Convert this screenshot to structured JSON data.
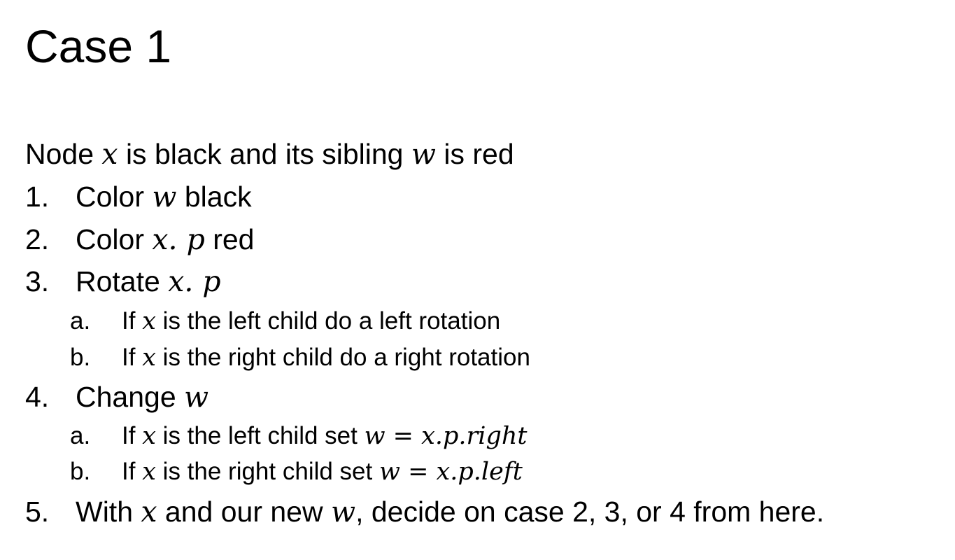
{
  "slide": {
    "title": "Case 1",
    "intro": {
      "t1": "Node ",
      "m1": "x",
      "t2": " is black and its sibling ",
      "m2": "w",
      "t3": " is red"
    },
    "steps": [
      {
        "num": "1.",
        "t1": "Color ",
        "m1": "w",
        "t2": " black"
      },
      {
        "num": "2.",
        "t1": "Color ",
        "m1": "x. p",
        "t2": " red"
      },
      {
        "num": "3.",
        "t1": "Rotate ",
        "m1": "x. p",
        "sub": [
          {
            "num": "a.",
            "t1": "If ",
            "m1": "x",
            "t2": " is the left child do a left rotation"
          },
          {
            "num": "b.",
            "t1": "If ",
            "m1": "x",
            "t2": " is the right child do a right rotation"
          }
        ]
      },
      {
        "num": "4.",
        "t1": "Change ",
        "m1": "w",
        "sub": [
          {
            "num": "a.",
            "t1": "If ",
            "m1": "x",
            "t2": " is the left child set ",
            "m2": "w",
            "eq": " = ",
            "m3": "x.p.right"
          },
          {
            "num": "b.",
            "t1": "If ",
            "m1": "x",
            "t2": " is the right child set ",
            "m2": "w",
            "eq": " = ",
            "m3": "x.p.left"
          }
        ]
      },
      {
        "num": "5.",
        "t1": "With ",
        "m1": "x",
        "t2": " and our new ",
        "m2": "w",
        "t3": ", decide on case 2, 3, or 4 from here."
      }
    ]
  }
}
